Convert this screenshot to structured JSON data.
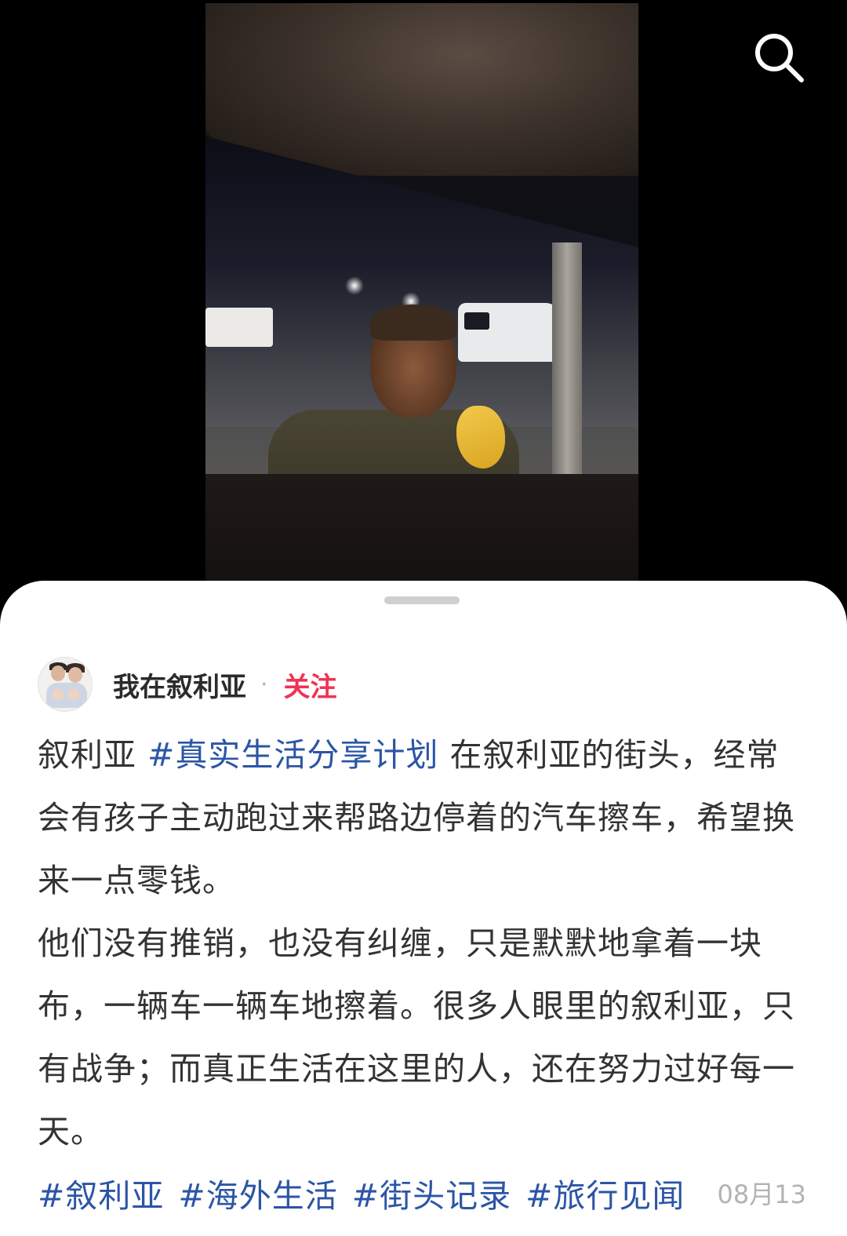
{
  "post": {
    "author": "我在叙利亚",
    "separator": "·",
    "follow_label": "关注",
    "lead": "叙利亚",
    "inline_tag": "#真实生活分享计划",
    "paragraph1_rest": "在叙利亚的街头，经常会有孩子主动跑过来帮路边停着的汽车擦车，希望换来一点零钱。",
    "paragraph2": "他们没有推销，也没有纠缠，只是默默地拿着一块布，一辆车一辆车地擦着。很多人眼里的叙利亚，只有战争；而真正生活在这里的人，还在努力过好每一天。",
    "tags": [
      "#叙利亚",
      "#海外生活",
      "#街头记录",
      "#旅行见闻"
    ],
    "date": "08月13"
  },
  "icons": {
    "search": "search-icon"
  },
  "colors": {
    "tag": "#2b55a6",
    "follow": "#ee3456",
    "date": "#b3b3b3",
    "text": "#333333"
  }
}
